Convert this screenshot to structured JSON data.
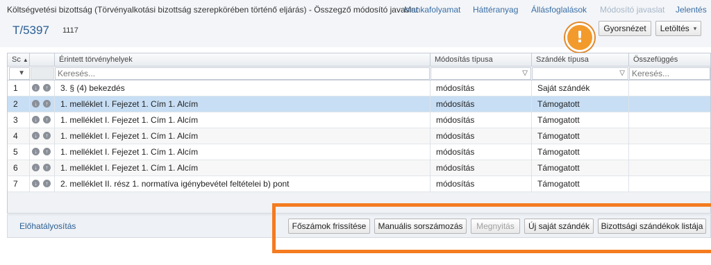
{
  "breadcrumb": "Költségvetési bizottság (Törvényalkotási bizottság szerepkörében történő eljárás) - Összegző módosító javaslat",
  "nav": [
    "Munkafolyamat",
    "Háttéranyag",
    "Állásfoglalások",
    "Módosító javaslat",
    "Jelentés"
  ],
  "doc": {
    "id": "T/5397",
    "number": "1117"
  },
  "toolbar": {
    "quick_view": "Gyorsnézet",
    "download": "Letöltés"
  },
  "columns": [
    "Sc",
    "",
    "Érintett törvényhelyek",
    "Módosítás típusa",
    "Szándék típusa",
    "Összefüggés"
  ],
  "filters": {
    "search_placeholder": "Keresés..."
  },
  "rows": [
    {
      "num": "1",
      "location": "3. § (4) bekezdés",
      "mod_type": "módosítás",
      "intent": "Saját szándék"
    },
    {
      "num": "2",
      "location": "1. melléklet I. Fejezet 1. Cím 1. Alcím",
      "mod_type": "módosítás",
      "intent": "Támogatott"
    },
    {
      "num": "3",
      "location": "1. melléklet I. Fejezet 1. Cím 1. Alcím",
      "mod_type": "módosítás",
      "intent": "Támogatott"
    },
    {
      "num": "4",
      "location": "1. melléklet I. Fejezet 1. Cím 1. Alcím",
      "mod_type": "módosítás",
      "intent": "Támogatott"
    },
    {
      "num": "5",
      "location": "1. melléklet I. Fejezet 1. Cím 1. Alcím",
      "mod_type": "módosítás",
      "intent": "Támogatott"
    },
    {
      "num": "6",
      "location": "1. melléklet I. Fejezet 1. Cím 1. Alcím",
      "mod_type": "módosítás",
      "intent": "Támogatott"
    },
    {
      "num": "7",
      "location": "2. melléklet II. rész 1. normatíva igénybevétel feltételei b) pont",
      "mod_type": "módosítás",
      "intent": "Támogatott"
    }
  ],
  "bottom": {
    "label": "Előhatályosítás",
    "buttons": [
      "Főszámok frissítése",
      "Manuális sorszámozás",
      "Megnyitás",
      "Új saját szándék",
      "Bizottsági szándékok listája"
    ]
  },
  "colors": {
    "accent": "#2a5e93",
    "highlight": "#f47b20",
    "selected_row": "#c7def4"
  }
}
